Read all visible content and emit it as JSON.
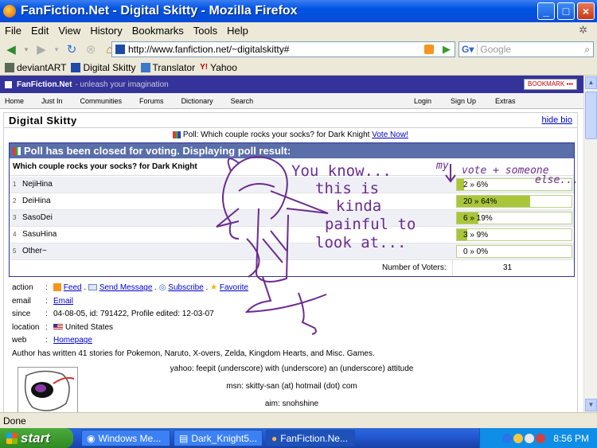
{
  "window": {
    "title": "FanFiction.Net - Digital Skitty - Mozilla Firefox"
  },
  "menu": [
    "File",
    "Edit",
    "View",
    "History",
    "Bookmarks",
    "Tools",
    "Help"
  ],
  "nav": {
    "url": "http://www.fanfiction.net/~digitalskitty#",
    "search_placeholder": "Google"
  },
  "bookmarks": [
    "deviantART",
    "Digital Skitty",
    "Translator",
    "Yahoo"
  ],
  "site": {
    "logo": "FanFiction.Net",
    "tagline": "- unleash your imagination",
    "bookmark_label": "BOOKMARK",
    "nav_left": [
      "Home",
      "Just In",
      "Communities",
      "Forums",
      "Dictionary",
      "Search"
    ],
    "nav_right": [
      "Login",
      "Sign Up",
      "Extras"
    ]
  },
  "profile": {
    "name": "Digital Skitty",
    "hide_bio": "hide bio",
    "poll_line": "Poll: Which couple rocks your socks? for Dark Knight",
    "vote_now": "Vote Now!"
  },
  "poll": {
    "header": "Poll has been closed for voting. Displaying poll result:",
    "question": "Which couple rocks your socks? for Dark Knight",
    "options": [
      {
        "num": "1",
        "label": "NejiHina",
        "votes": 2,
        "pct": 6,
        "text": "2 » 6%"
      },
      {
        "num": "2",
        "label": "DeiHina",
        "votes": 20,
        "pct": 64,
        "text": "20 » 64%"
      },
      {
        "num": "3",
        "label": "SasoDei",
        "votes": 6,
        "pct": 19,
        "text": "6 » 19%"
      },
      {
        "num": "4",
        "label": "SasuHina",
        "votes": 3,
        "pct": 9,
        "text": "3 » 9%"
      },
      {
        "num": "5",
        "label": "Other~",
        "votes": 0,
        "pct": 0,
        "text": "0 » 0%"
      }
    ],
    "voters_label": "Number of Voters:",
    "voters": "31"
  },
  "info": {
    "action_label": "action",
    "actions": [
      "Feed",
      "Send Message",
      "Subscribe",
      "Favorite"
    ],
    "email_label": "email",
    "email": "Email",
    "since_label": "since",
    "since": "04-08-05, id: 791422, Profile edited: 12-03-07",
    "location_label": "location",
    "location": "United States",
    "web_label": "web",
    "web": "Homepage",
    "stories": "Author has written 41 stories for Pokemon, Naruto, X-overs, Zelda, Kingdom Hearts, and Misc. Games.",
    "yahoo": "yahoo: feepit (underscore) with (underscore) an (underscore) attitude",
    "msn": "msn: skitty-san (at) hotmail (dot) com",
    "aim": "aim: snohshine"
  },
  "doodle": {
    "lines": [
      "You know...",
      "this is",
      "kinda",
      "painful to",
      "look at..."
    ],
    "note1": "my",
    "note2": "vote + someone",
    "note3": "else..."
  },
  "status": {
    "text": "Done"
  },
  "taskbar": {
    "start": "start",
    "tasks": [
      "Windows Me...",
      "Dark_Knight5...",
      "FanFiction.Ne..."
    ],
    "clock": "8:56 PM"
  },
  "colors": {
    "accent": "#333399",
    "bar": "#a9c63a",
    "doodle": "#6b2c8f"
  }
}
